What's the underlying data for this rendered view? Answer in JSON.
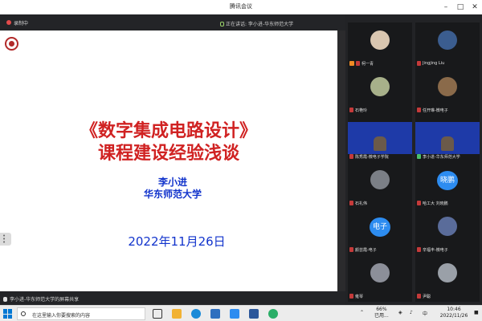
{
  "window": {
    "title": "腾讯会议"
  },
  "toolbar": {
    "recording_label": "录制中",
    "speaking_label": "正在讲话: 李小进-华东师范大学"
  },
  "slide": {
    "title_line1": "《数字集成电路设计》",
    "title_line2": "课程建设经验浅谈",
    "author": "李小进",
    "organization": "华东师范大学",
    "date": "2022年11月26日"
  },
  "participants": [
    {
      "name": "柯一青",
      "mic": "muted",
      "type": "avatar",
      "avatar_color": "#d9c6b0",
      "hand": true
    },
    {
      "name": "Jingjing Liu",
      "mic": "muted",
      "type": "avatar",
      "avatar_color": "#3b5d8f"
    },
    {
      "name": "石艳玲",
      "mic": "muted",
      "type": "avatar",
      "avatar_color": "#a7b08a"
    },
    {
      "name": "任开琳-微电子",
      "mic": "muted",
      "type": "avatar",
      "avatar_color": "#8a6a4a"
    },
    {
      "name": "陈秀霞-微电子学院",
      "mic": "muted",
      "type": "video"
    },
    {
      "name": "李小进-华东师范大学",
      "mic": "on",
      "type": "video"
    },
    {
      "name": "石礼伟",
      "mic": "muted",
      "type": "avatar",
      "avatar_color": "#7b7f86"
    },
    {
      "name": "哈工大 刘晓鹏",
      "mic": "muted",
      "type": "text",
      "avatar_text": "晓鹏"
    },
    {
      "name": "颜芸霞-电子",
      "mic": "muted",
      "type": "text",
      "avatar_text": "电子"
    },
    {
      "name": "辛福丰-微电子",
      "mic": "muted",
      "type": "avatar",
      "avatar_color": "#5a6c9a"
    },
    {
      "name": "雍琴",
      "mic": "muted",
      "type": "avatar",
      "avatar_color": "#8c8f99"
    },
    {
      "name": "尹聪",
      "mic": "muted",
      "type": "avatar",
      "avatar_color": "#9aa0a8"
    }
  ],
  "presenter_bar": {
    "text": "李小进-华东师范大学的屏幕共享"
  },
  "taskbar": {
    "search_placeholder": "在这里输入你要搜索的内容",
    "battery": "66%",
    "battery_sub": "已用...",
    "ime": "中",
    "time": "10:46",
    "date": "2022/11/26"
  }
}
